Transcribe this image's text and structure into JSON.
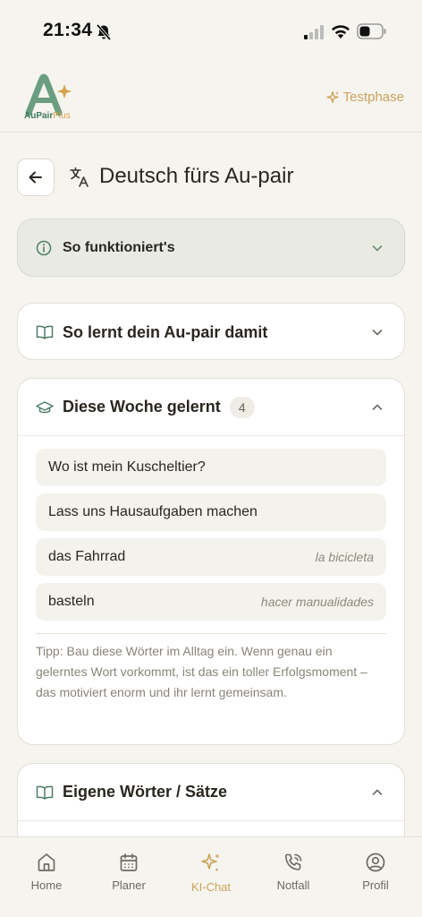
{
  "status": {
    "time": "21:34"
  },
  "header": {
    "logo_name": "AuPair",
    "logo_plus": "Plus",
    "trial_label": "Testphase"
  },
  "page": {
    "title": "Deutsch fürs Au-pair"
  },
  "sections": {
    "info": {
      "title": "So funktioniert's"
    },
    "learn": {
      "title": "So lernt dein Au-pair damit"
    },
    "week": {
      "title": "Diese Woche gelernt",
      "count": "4",
      "items": [
        {
          "de": "Wo ist mein Kuscheltier?",
          "es": ""
        },
        {
          "de": "Lass uns Hausaufgaben machen",
          "es": ""
        },
        {
          "de": "das Fahrrad",
          "es": "la bicicleta"
        },
        {
          "de": "basteln",
          "es": "hacer manualidades"
        }
      ],
      "tip": "Tipp: Bau diese Wörter im Alltag ein. Wenn genau ein gelerntes Wort vorkommt, ist das ein toller Erfolgsmoment – das motiviert enorm und ihr lernt gemeinsam."
    },
    "own": {
      "title": "Eigene Wörter / Sätze"
    }
  },
  "nav": [
    {
      "label": "Home",
      "icon": "home-icon",
      "active": false
    },
    {
      "label": "Planer",
      "icon": "calendar-icon",
      "active": false
    },
    {
      "label": "KI-Chat",
      "icon": "sparkle-icon",
      "active": true
    },
    {
      "label": "Notfall",
      "icon": "phone-icon",
      "active": false
    },
    {
      "label": "Profil",
      "icon": "user-circle-icon",
      "active": false
    }
  ],
  "colors": {
    "background": "#f6f4ee",
    "accent_gold": "#c9a35e",
    "brand_green": "#3d7a5e",
    "info_bg": "#e9ebe2"
  }
}
